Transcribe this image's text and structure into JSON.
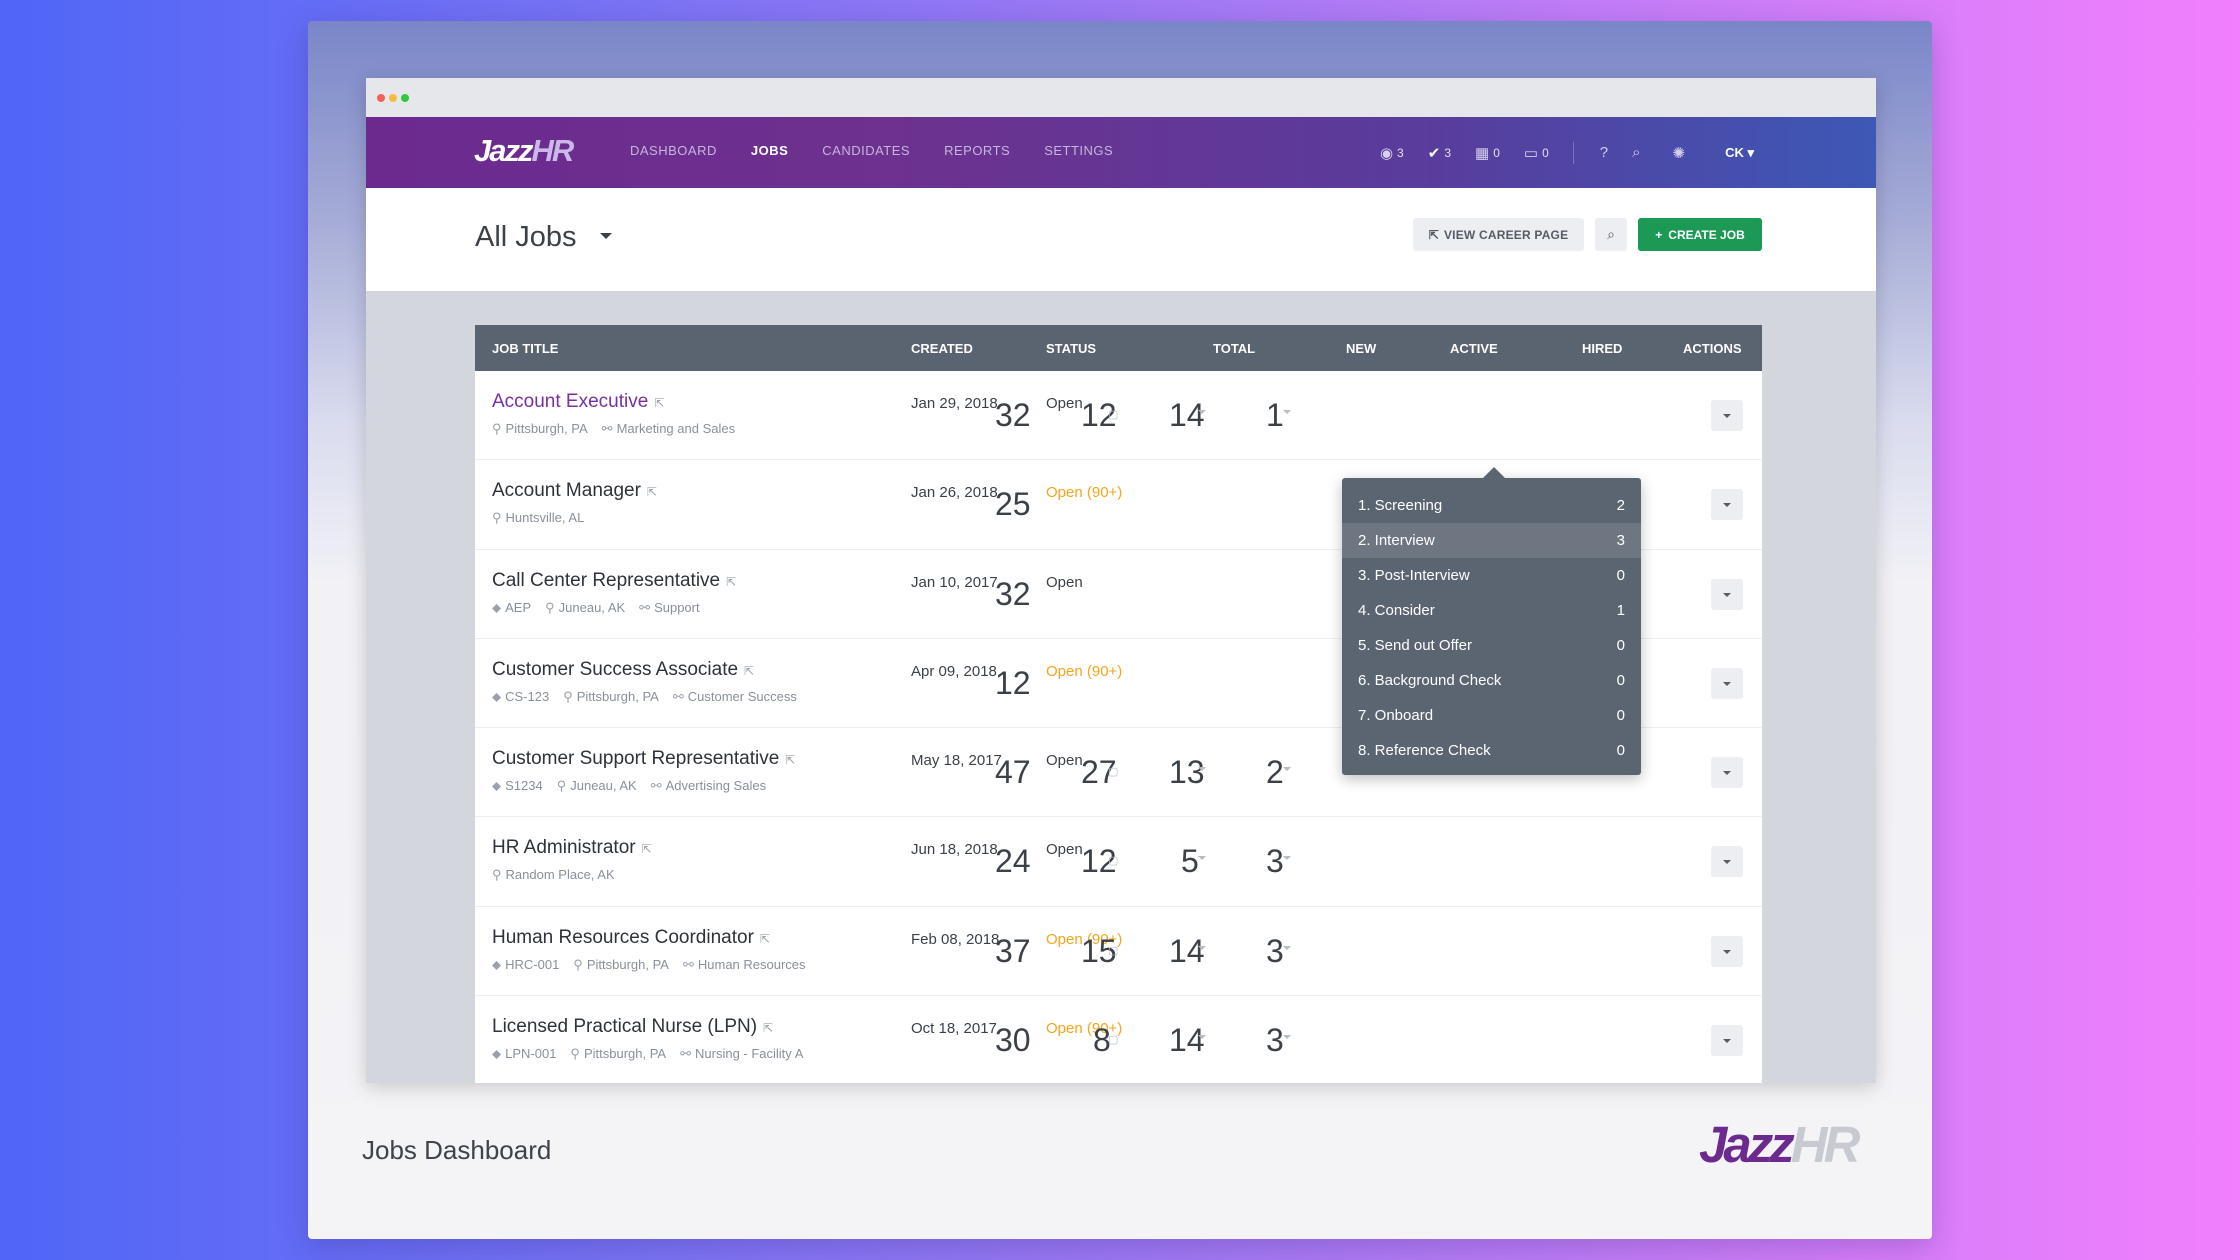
{
  "app": {
    "logo_a": "Jazz",
    "logo_b": "HR",
    "nav": [
      "DASHBOARD",
      "JOBS",
      "CANDIDATES",
      "REPORTS",
      "SETTINGS"
    ],
    "active_nav": "JOBS",
    "counters": {
      "views": "3",
      "tasks": "3",
      "events": "0",
      "inbox": "0"
    },
    "user": "CK"
  },
  "header": {
    "title": "All Jobs",
    "view_career_page": "VIEW CAREER PAGE",
    "create_job": "CREATE JOB"
  },
  "table": {
    "columns": [
      "JOB TITLE",
      "CREATED",
      "STATUS",
      "TOTAL",
      "NEW",
      "ACTIVE",
      "HIRED",
      "ACTIONS"
    ],
    "rows": [
      {
        "title": "Account Executive",
        "tag": "",
        "location": "Pittsburgh, PA",
        "department": "Marketing and Sales",
        "created": "Jan 29, 2018",
        "status": "Open",
        "total": "32",
        "new": "12",
        "active": "14",
        "hired": "1"
      },
      {
        "title": "Account Manager",
        "tag": "",
        "location": "Huntsville, AL",
        "department": "",
        "created": "Jan 26, 2018",
        "status": "Open (90+)",
        "total": "25",
        "new": "",
        "active": "",
        "hired": ""
      },
      {
        "title": "Call Center Representative",
        "tag": "AEP",
        "location": "Juneau, AK",
        "department": "Support",
        "created": "Jan 10, 2017",
        "status": "Open",
        "total": "32",
        "new": "",
        "active": "",
        "hired": ""
      },
      {
        "title": "Customer Success Associate",
        "tag": "CS-123",
        "location": "Pittsburgh, PA",
        "department": "Customer Success",
        "created": "Apr 09, 2018",
        "status": "Open (90+)",
        "total": "12",
        "new": "",
        "active": "",
        "hired": ""
      },
      {
        "title": "Customer Support Representative",
        "tag": "S1234",
        "location": "Juneau, AK",
        "department": "Advertising Sales",
        "created": "May 18, 2017",
        "status": "Open",
        "total": "47",
        "new": "27",
        "active": "13",
        "hired": "2"
      },
      {
        "title": "HR Administrator",
        "tag": "",
        "location": "Random Place, AK",
        "department": "",
        "created": "Jun 18, 2018",
        "status": "Open",
        "total": "24",
        "new": "12",
        "active": "5",
        "hired": "3"
      },
      {
        "title": "Human Resources Coordinator",
        "tag": "HRC-001",
        "location": "Pittsburgh, PA",
        "department": "Human Resources",
        "created": "Feb 08, 2018",
        "status": "Open (90+)",
        "total": "37",
        "new": "15",
        "active": "14",
        "hired": "3"
      },
      {
        "title": "Licensed Practical Nurse (LPN)",
        "tag": "LPN-001",
        "location": "Pittsburgh, PA",
        "department": "Nursing - Facility A",
        "created": "Oct 18, 2017",
        "status": "Open (90+)",
        "total": "30",
        "new": "8",
        "active": "14",
        "hired": "3"
      }
    ]
  },
  "popover": {
    "stages": [
      {
        "label": "1. Screening",
        "count": "2"
      },
      {
        "label": "2. Interview",
        "count": "3"
      },
      {
        "label": "3. Post-Interview",
        "count": "0"
      },
      {
        "label": "4. Consider",
        "count": "1"
      },
      {
        "label": "5. Send out Offer",
        "count": "0"
      },
      {
        "label": "6. Background Check",
        "count": "0"
      },
      {
        "label": "7. Onboard",
        "count": "0"
      },
      {
        "label": "8. Reference Check",
        "count": "0"
      }
    ]
  },
  "caption": "Jobs Dashboard",
  "brand": {
    "a": "Jazz",
    "b": "HR"
  },
  "colors": {
    "purple": "#6c2a8f",
    "green": "#1c9a55",
    "warning": "#f4a51c",
    "table_header": "#5a6470"
  }
}
